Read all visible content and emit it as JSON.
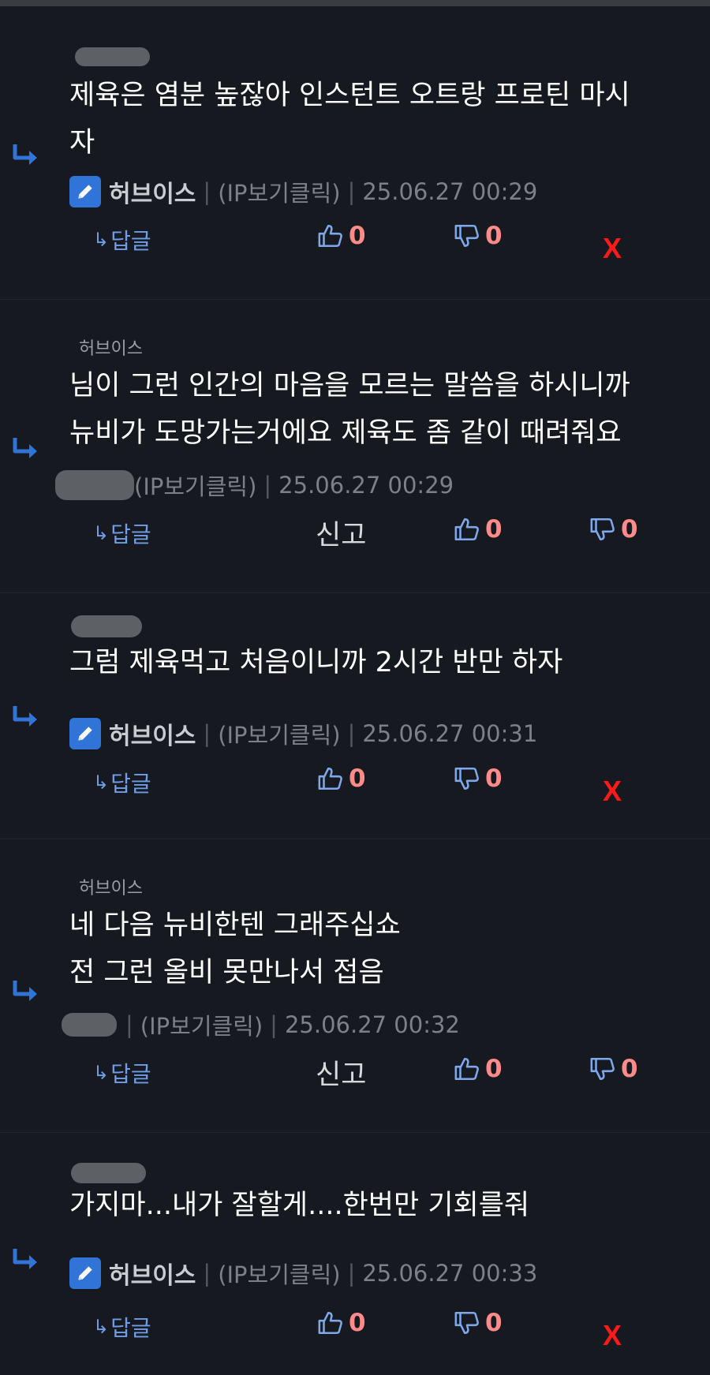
{
  "ip_label": "(IP보기클릭)",
  "reply_label": "답글",
  "report_label": "신고",
  "delete_label": "X",
  "colors": {
    "background": "#16191f",
    "link": "#6f9de8",
    "vote_count": "#ff8a8a",
    "delete": "#ff1a1a",
    "badge": "#2f74d6"
  },
  "comments": [
    {
      "quote": "",
      "text": "제육은 염분 높잖아 인스턴트 오트랑 프로틴 마시\n자",
      "author": "허브이스",
      "datetime": "25.06.27 00:29",
      "upvotes": "0",
      "downvotes": "0",
      "own": true
    },
    {
      "quote": "허브이스",
      "text": "님이 그런 인간의 마음을 모르는 말씀을 하시니까\n뉴비가 도망가는거에요 제육도 좀 같이 때려줘요",
      "author": "",
      "datetime": "25.06.27 00:29",
      "upvotes": "0",
      "downvotes": "0",
      "own": false
    },
    {
      "quote": "",
      "text": "그럼 제육먹고 처음이니까 2시간 반만 하자",
      "author": "허브이스",
      "datetime": "25.06.27 00:31",
      "upvotes": "0",
      "downvotes": "0",
      "own": true
    },
    {
      "quote": "허브이스",
      "text": "네 다음 뉴비한텐 그래주십쇼\n전 그런 올비 못만나서 접음",
      "author": "",
      "datetime": "25.06.27 00:32",
      "upvotes": "0",
      "downvotes": "0",
      "own": false
    },
    {
      "quote": "",
      "text": "가지마...내가 잘할게....한번만 기회를줘",
      "author": "허브이스",
      "datetime": "25.06.27 00:33",
      "upvotes": "0",
      "downvotes": "0",
      "own": true
    }
  ]
}
